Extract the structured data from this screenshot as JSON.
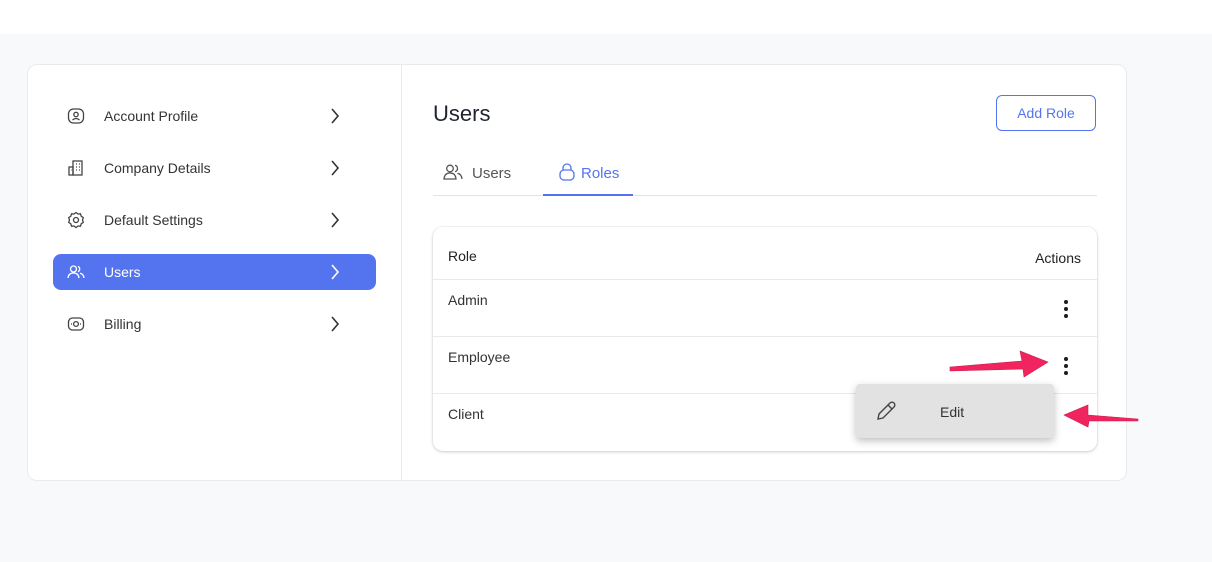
{
  "sidebar": {
    "items": [
      {
        "label": "Account Profile",
        "icon": "account-profile-icon"
      },
      {
        "label": "Company Details",
        "icon": "building-icon"
      },
      {
        "label": "Default Settings",
        "icon": "gear-icon"
      },
      {
        "label": "Users",
        "icon": "users-icon",
        "active": true
      },
      {
        "label": "Billing",
        "icon": "billing-icon"
      }
    ]
  },
  "header": {
    "title": "Users",
    "add_role_label": "Add Role"
  },
  "tabs": [
    {
      "label": "Users",
      "icon": "users-icon"
    },
    {
      "label": "Roles",
      "icon": "lock-icon",
      "active": true
    }
  ],
  "table": {
    "columns": [
      "Role",
      "Actions"
    ],
    "rows": [
      {
        "role": "Admin"
      },
      {
        "role": "Employee"
      },
      {
        "role": "Client"
      }
    ]
  },
  "context_menu": {
    "items": [
      {
        "label": "Edit",
        "icon": "pencil-icon"
      }
    ]
  },
  "colors": {
    "accent": "#5474ef",
    "annotation_arrow": "#f0245e",
    "page_background": "#f8f9fb"
  }
}
